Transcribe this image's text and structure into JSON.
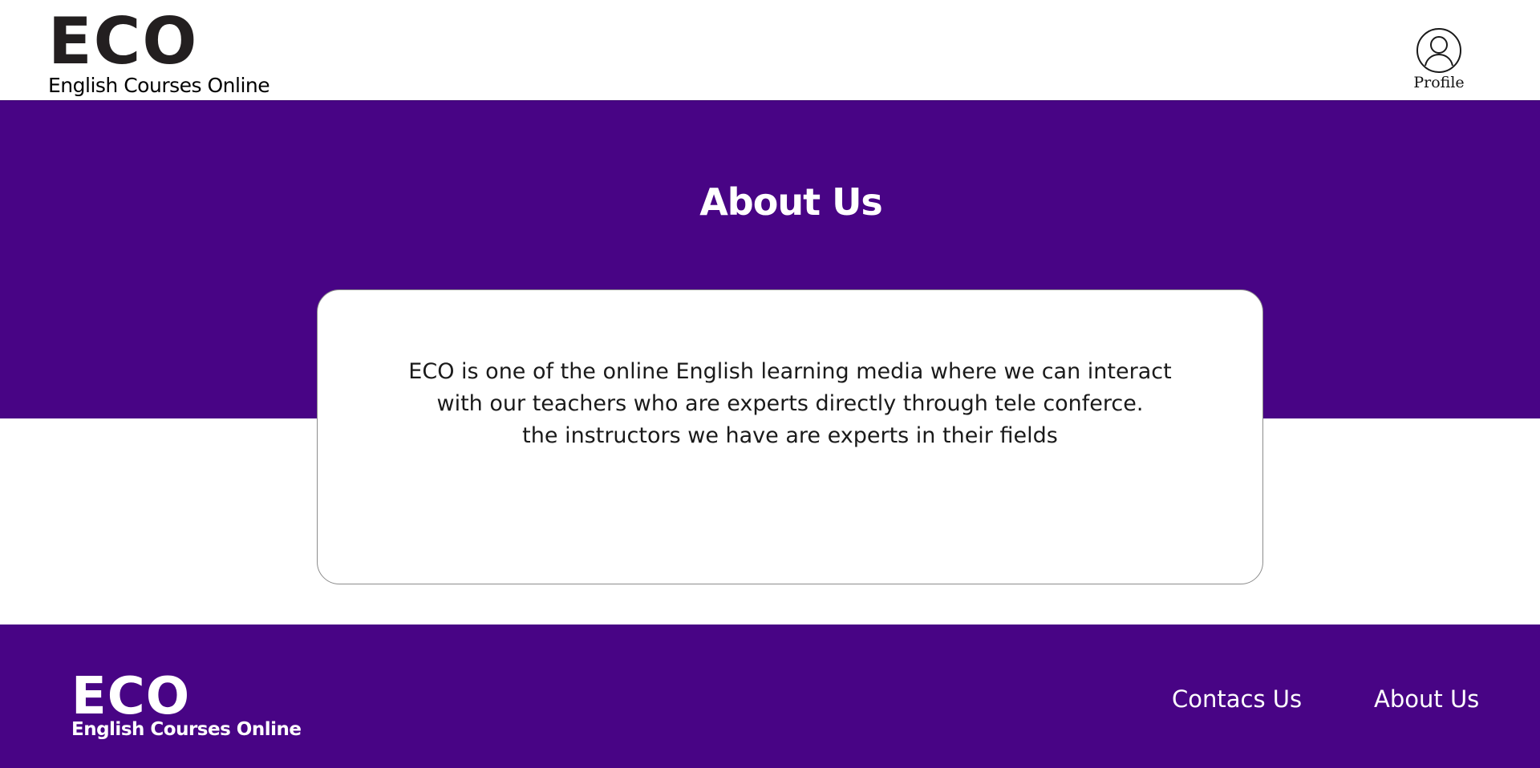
{
  "header": {
    "logo_mark": "ECO",
    "logo_subtitle": "English Courses Online",
    "profile_label": "Profile",
    "profile_icon": "user-circle-icon"
  },
  "hero": {
    "title": "About Us",
    "background_color": "#480485"
  },
  "about_card": {
    "text": "ECO is one of the online English learning media where we can interact\nwith our teachers who are experts directly through tele conferce.\nthe instructors we have are experts in their fields"
  },
  "footer": {
    "logo_mark": "ECO",
    "logo_subtitle": "English Courses Online",
    "links": [
      {
        "label": "Contacs Us"
      },
      {
        "label": "About Us"
      }
    ],
    "background_color": "#480485"
  }
}
